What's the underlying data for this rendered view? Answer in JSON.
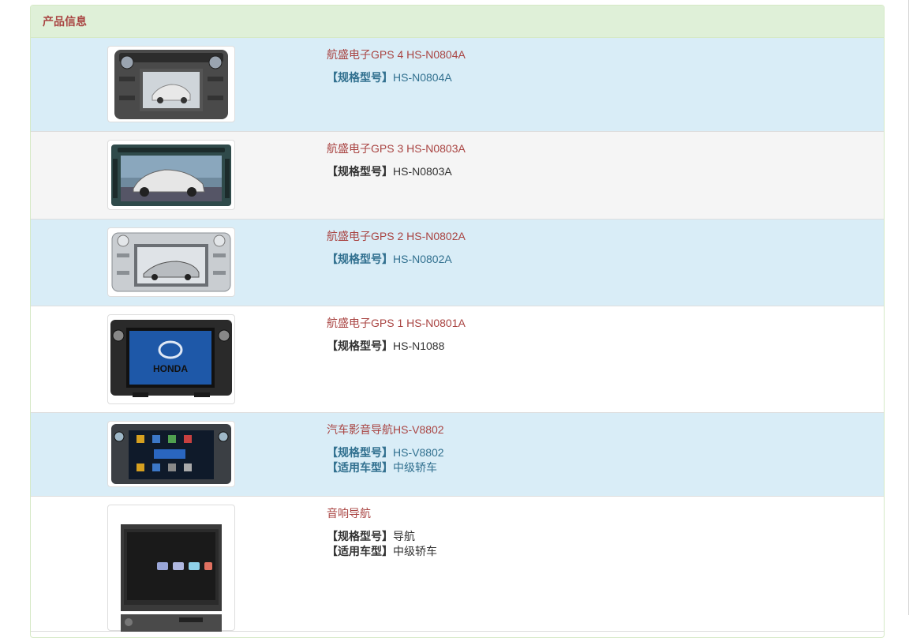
{
  "panel": {
    "heading": "产品信息"
  },
  "products": [
    {
      "title": "航盛电子GPS 4 HS-N0804A",
      "spec_label": "【规格型号】",
      "spec_value": "HS-N0804A",
      "image": "car-dvd-gps-unit-image"
    },
    {
      "title": "航盛电子GPS 3 HS-N0803A",
      "spec_label": "【规格型号】",
      "spec_value": "HS-N0803A",
      "image": "car-dvd-gps-unit-image"
    },
    {
      "title": "航盛电子GPS 2 HS-N0802A",
      "spec_label": "【规格型号】",
      "spec_value": "HS-N0802A",
      "image": "car-dvd-gps-unit-image"
    },
    {
      "title": "航盛电子GPS 1 HS-N0801A",
      "spec_label": "【规格型号】",
      "spec_value": "HS-N1088",
      "image": "honda-gps-unit-image"
    },
    {
      "title": "汽车影音导航HS-V8802",
      "spec_label": "【规格型号】",
      "spec_value": "HS-V8802",
      "vehicle_label": "【适用车型】",
      "vehicle_value": "中级轿车",
      "image": "multimedia-menu-unit-image"
    },
    {
      "title": "音响导航",
      "spec_label": "【规格型号】",
      "spec_value": "导航",
      "vehicle_label": "【适用车型】",
      "vehicle_value": "中级轿车",
      "image": "flip-screen-unit-image"
    }
  ],
  "colors": {
    "heading_bg": "#dff0d8",
    "heading_text": "#a94442",
    "info_row": "#d9edf7",
    "gray_row": "#f5f5f5",
    "info_text": "#31708f"
  }
}
